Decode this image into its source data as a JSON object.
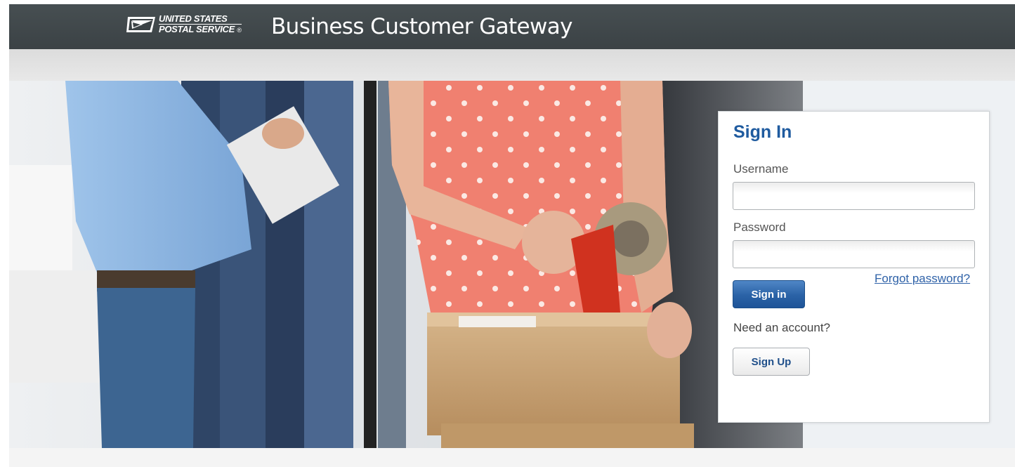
{
  "header": {
    "logo_line1": "UNITED STATES",
    "logo_line2": "POSTAL SERVICE",
    "logo_reg": "®",
    "title": "Business Customer Gateway"
  },
  "signin": {
    "title": "Sign In",
    "username_label": "Username",
    "username_value": "",
    "password_label": "Password",
    "password_value": "",
    "forgot_link": "Forgot password?",
    "signin_button": "Sign in",
    "need_account": "Need an account?",
    "signup_button": "Sign Up"
  },
  "colors": {
    "header_bg": "#3f4649",
    "brand_blue": "#1f5b9f",
    "link_blue": "#2f62a8",
    "button_blue": "#2a62a6"
  },
  "icons": {
    "logo": "usps-eagle-logo-icon"
  }
}
